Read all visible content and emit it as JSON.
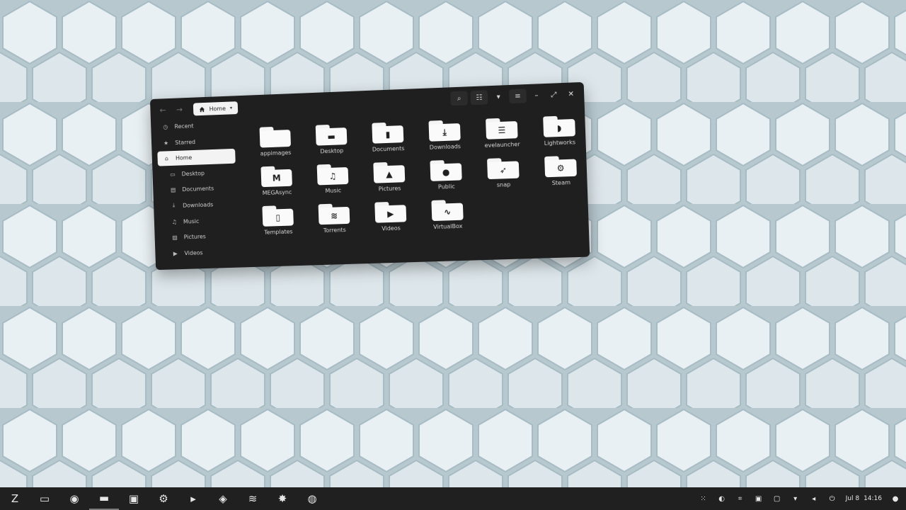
{
  "window": {
    "back_glyph": "←",
    "forward_glyph": "→",
    "location": "Home",
    "location_caret": "▾",
    "tool_glyphs": {
      "search": "⌕",
      "view_toggle": "☷",
      "view_menu": "▾",
      "main_menu": "≡",
      "minimize": "–",
      "maximize": "⤢",
      "close": "✕"
    }
  },
  "sidebar": {
    "items": [
      {
        "label": "Recent",
        "glyph": "◷"
      },
      {
        "label": "Starred",
        "glyph": "★"
      },
      {
        "label": "Home",
        "glyph": "⌂"
      },
      {
        "label": "Desktop",
        "glyph": "▭"
      },
      {
        "label": "Documents",
        "glyph": "▤"
      },
      {
        "label": "Downloads",
        "glyph": "⤓"
      },
      {
        "label": "Music",
        "glyph": "♫"
      },
      {
        "label": "Pictures",
        "glyph": "▨"
      },
      {
        "label": "Videos",
        "glyph": "▶"
      }
    ]
  },
  "folders": [
    {
      "label": "appimages",
      "emblem": ""
    },
    {
      "label": "Desktop",
      "emblem": "▬"
    },
    {
      "label": "Documents",
      "emblem": "▮"
    },
    {
      "label": "Downloads",
      "emblem": "⤓"
    },
    {
      "label": "evelauncher",
      "emblem": "☰"
    },
    {
      "label": "Lightworks",
      "emblem": "◗"
    },
    {
      "label": "MEGAsync",
      "emblem": "M"
    },
    {
      "label": "Music",
      "emblem": "♫"
    },
    {
      "label": "Pictures",
      "emblem": "▲"
    },
    {
      "label": "Public",
      "emblem": "●"
    },
    {
      "label": "snap",
      "emblem": "➶"
    },
    {
      "label": "Steam",
      "emblem": "⚙"
    },
    {
      "label": "Templates",
      "emblem": "▯"
    },
    {
      "label": "Torrents",
      "emblem": "≋"
    },
    {
      "label": "Videos",
      "emblem": "▶"
    },
    {
      "label": "VirtualBox",
      "emblem": "∿"
    }
  ],
  "taskbar": {
    "apps": [
      {
        "name": "zorin-menu",
        "glyph": "Z"
      },
      {
        "name": "workspaces",
        "glyph": "▭"
      },
      {
        "name": "firefox",
        "glyph": "◉"
      },
      {
        "name": "files",
        "glyph": "▬"
      },
      {
        "name": "software",
        "glyph": "▣"
      },
      {
        "name": "steam",
        "glyph": "⚙"
      },
      {
        "name": "terminal",
        "glyph": "▸"
      },
      {
        "name": "nvidia-settings",
        "glyph": "◈"
      },
      {
        "name": "spotify",
        "glyph": "≋"
      },
      {
        "name": "lightworks",
        "glyph": "✸"
      },
      {
        "name": "obs",
        "glyph": "◍"
      }
    ],
    "tray_glyphs": [
      "⁙",
      "◐",
      "⌗",
      "▣",
      "▢",
      "▾",
      "◂",
      "⏻"
    ],
    "date": "Jul 8",
    "time": "14:16",
    "status_glyph": "●"
  },
  "colors": {
    "window_bg": "#1f1f1f",
    "taskbar_bg": "#202020",
    "wallpaper_hex_light": "#e9f0f3",
    "wallpaper_hex_shadow": "#9fb4bd"
  }
}
